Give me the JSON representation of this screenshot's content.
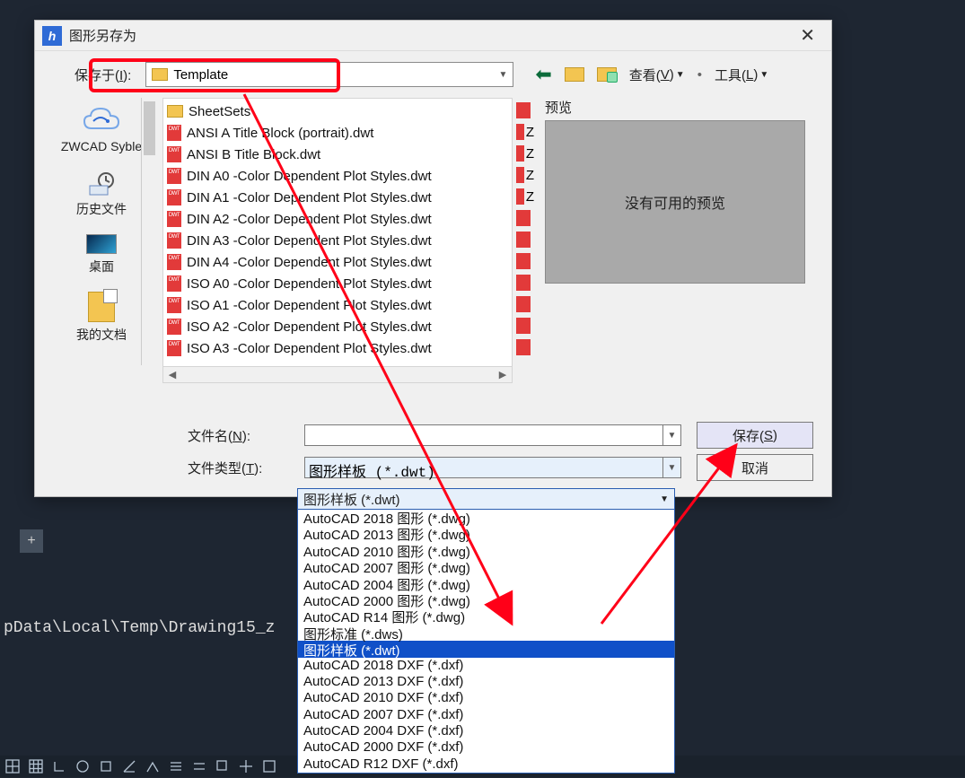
{
  "dialog": {
    "title": "图形另存为",
    "save_in_label_pre": "保存于(",
    "save_in_label_key": "I",
    "save_in_label_post": "):",
    "save_in_value": "Template",
    "view_label_pre": "查看(",
    "view_label_key": "V",
    "view_label_post": ")",
    "tools_label_pre": "工具(",
    "tools_label_key": "L",
    "tools_label_post": ")"
  },
  "sidebar": {
    "items": [
      {
        "label": "ZWCAD Syble"
      },
      {
        "label": "历史文件"
      },
      {
        "label": "桌面"
      },
      {
        "label": "我的文档"
      }
    ]
  },
  "files": [
    {
      "icon": "folder",
      "name": "SheetSets"
    },
    {
      "icon": "dwt",
      "name": "ANSI A Title Block (portrait).dwt"
    },
    {
      "icon": "dwt",
      "name": "ANSI B Title Block.dwt"
    },
    {
      "icon": "dwt",
      "name": "DIN A0 -Color Dependent Plot Styles.dwt"
    },
    {
      "icon": "dwt",
      "name": "DIN A1 -Color Dependent Plot Styles.dwt"
    },
    {
      "icon": "dwt",
      "name": "DIN A2 -Color Dependent Plot Styles.dwt"
    },
    {
      "icon": "dwt",
      "name": "DIN A3 -Color Dependent Plot Styles.dwt"
    },
    {
      "icon": "dwt",
      "name": "DIN A4 -Color Dependent Plot Styles.dwt"
    },
    {
      "icon": "dwt",
      "name": "ISO A0 -Color Dependent Plot Styles.dwt"
    },
    {
      "icon": "dwt",
      "name": "ISO A1 -Color Dependent Plot Styles.dwt"
    },
    {
      "icon": "dwt",
      "name": "ISO A2 -Color Dependent Plot Styles.dwt"
    },
    {
      "icon": "dwt",
      "name": "ISO A3 -Color Dependent Plot Styles.dwt"
    }
  ],
  "col2_hints": [
    "",
    "Z",
    "Z",
    "Z",
    "Z",
    "",
    "",
    "",
    "",
    "",
    "",
    ""
  ],
  "preview": {
    "label": "预览",
    "text": "没有可用的预览"
  },
  "filename": {
    "label_pre": "文件名(",
    "label_key": "N",
    "label_post": "):",
    "value": ""
  },
  "filetype": {
    "label_pre": "文件类型(",
    "label_key": "T",
    "label_post": "):",
    "selected": "图形样板 (*.dwt)",
    "options": [
      "AutoCAD 2018 图形 (*.dwg)",
      "AutoCAD 2013 图形 (*.dwg)",
      "AutoCAD 2010 图形 (*.dwg)",
      "AutoCAD 2007 图形 (*.dwg)",
      "AutoCAD 2004 图形 (*.dwg)",
      "AutoCAD 2000 图形 (*.dwg)",
      "AutoCAD R14 图形 (*.dwg)",
      "图形标准 (*.dws)",
      "图形样板 (*.dwt)",
      "AutoCAD 2018 DXF (*.dxf)",
      "AutoCAD 2013 DXF (*.dxf)",
      "AutoCAD 2010 DXF (*.dxf)",
      "AutoCAD 2007 DXF (*.dxf)",
      "AutoCAD 2004 DXF (*.dxf)",
      "AutoCAD 2000 DXF (*.dxf)",
      "AutoCAD R12 DXF (*.dxf)"
    ],
    "highlight_index": 8
  },
  "buttons": {
    "save_pre": "保存(",
    "save_key": "S",
    "save_post": ")",
    "cancel": "取消"
  },
  "status_path": "pData\\Local\\Temp\\Drawing15_z",
  "tab_plus": "+"
}
